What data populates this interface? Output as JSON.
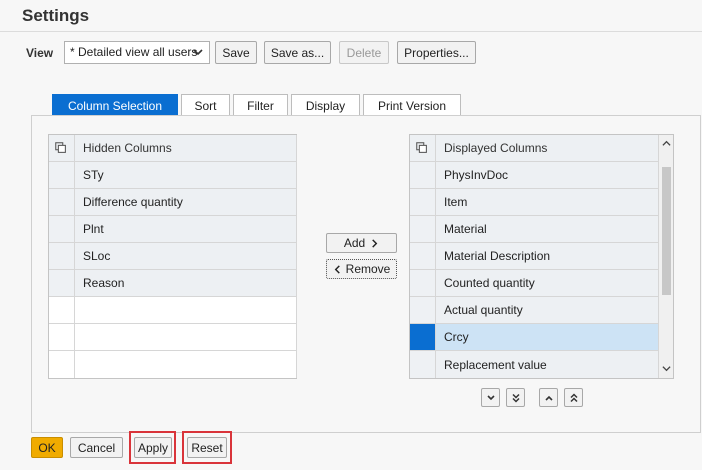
{
  "title": "Settings",
  "view": {
    "label": "View",
    "selected": "* Detailed view all users",
    "buttons": {
      "save": "Save",
      "save_as": "Save as...",
      "delete": "Delete",
      "properties": "Properties..."
    }
  },
  "tabs": [
    {
      "label": "Column Selection",
      "active": true
    },
    {
      "label": "Sort",
      "active": false
    },
    {
      "label": "Filter",
      "active": false
    },
    {
      "label": "Display",
      "active": false
    },
    {
      "label": "Print Version",
      "active": false
    }
  ],
  "hidden_columns": {
    "header": "Hidden Columns",
    "rows": [
      "STy",
      "Difference quantity",
      "Plnt",
      "SLoc",
      "Reason"
    ]
  },
  "displayed_columns": {
    "header": "Displayed Columns",
    "rows": [
      "PhysInvDoc",
      "Item",
      "Material",
      "Material Description",
      "Counted quantity",
      "Actual quantity",
      "Crcy",
      "Replacement value"
    ],
    "selected_row": "Crcy"
  },
  "move": {
    "add": "Add",
    "remove": "Remove"
  },
  "footer": {
    "ok": "OK",
    "cancel": "Cancel",
    "apply": "Apply",
    "reset": "Reset"
  },
  "colors": {
    "accent": "#0a6ed1",
    "ok_button": "#f0ab00",
    "highlight_box": "#d9343a"
  }
}
